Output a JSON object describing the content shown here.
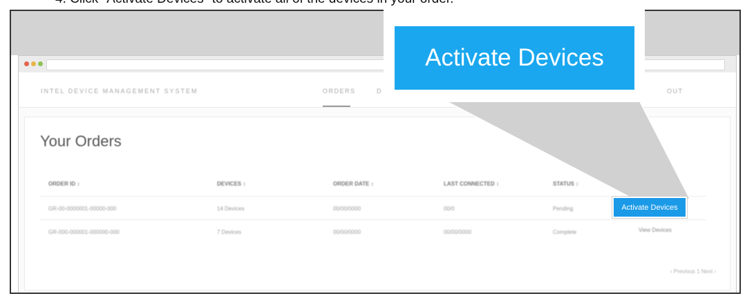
{
  "instruction": {
    "text": "4.  Click \"Activate Devices\" to activate all of the devices in your order."
  },
  "browser": {
    "brand": "INTEL DEVICE MANAGEMENT SYSTEM",
    "nav": [
      "ORDERS",
      "D",
      "OUT"
    ]
  },
  "page": {
    "title": "Your Orders",
    "columns": [
      "ORDER ID ↕",
      "DEVICES ↕",
      "ORDER DATE ↕",
      "LAST CONNECTED ↕",
      "STATUS ↕"
    ],
    "rows": [
      {
        "order_id": "GR-00-0000001-00000-000",
        "devices": "14 Devices",
        "order_date": "00/00/0000",
        "last_connected": "00/0",
        "status": "Pending",
        "action": "Activate Devices"
      },
      {
        "order_id": "GR-000-000001-000000-000",
        "devices": "7 Devices",
        "order_date": "00/00/0000",
        "last_connected": "00/00/0000",
        "status": "Complete",
        "action": "View Devices"
      }
    ],
    "pagination": "‹ Previous  1  Next ›"
  },
  "callout": {
    "label": "Activate Devices"
  },
  "colors": {
    "accent": "#1aa7ef",
    "button_small": "#1b9ae8",
    "highlight_zone": "#d3d3d3"
  }
}
